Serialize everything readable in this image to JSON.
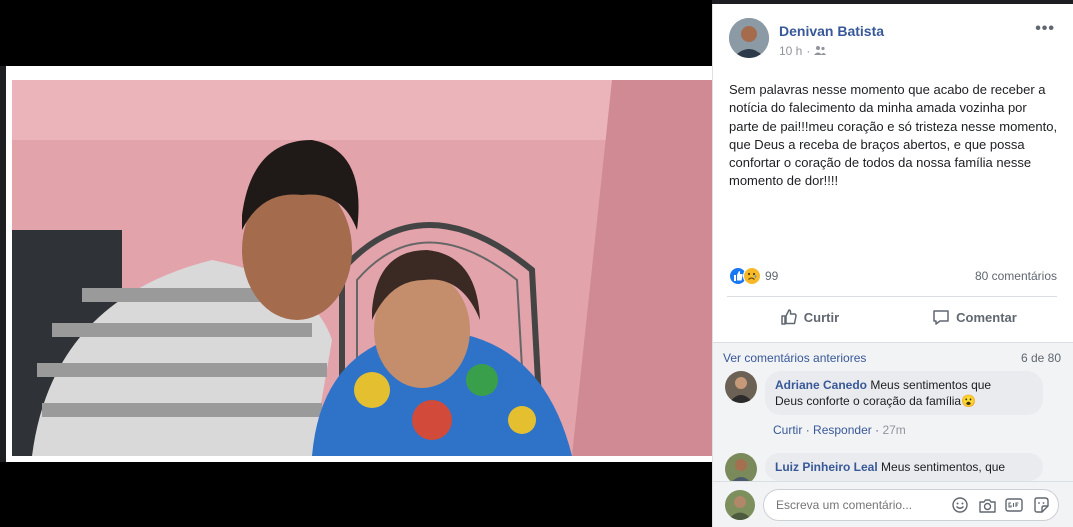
{
  "post": {
    "author": "Denivan Batista",
    "time": "10 h",
    "audience_icon": "friends-icon",
    "more_label": "•••",
    "text": "Sem palavras nesse momento que acabo de receber a notícia do falecimento da minha amada vozinha por parte de pai!!!meu coração e só tristeza nesse momento, que Deus a receba de braços abertos, e que possa confortar o coração de todos da nossa família nesse momento de dor!!!!"
  },
  "reactions": {
    "icons": [
      "like-icon",
      "sad-icon"
    ],
    "count": "99",
    "comments_label": "80 comentários"
  },
  "actions": {
    "like_label": "Curtir",
    "comment_label": "Comentar"
  },
  "comments": {
    "view_previous": "Ver comentários anteriores",
    "pagination": "6 de 80",
    "items": [
      {
        "name": "Adriane Canedo",
        "text_line1": "Meus sentimentos que",
        "text_line2": "Deus conforte o coração da família😮",
        "like": "Curtir",
        "reply": "Responder",
        "time": "27m"
      },
      {
        "name": "Luiz Pinheiro Leal",
        "text_line1": "Meus sentimentos, que"
      }
    ]
  },
  "composer": {
    "placeholder": "Escreva um comentário...",
    "icons": [
      "emoji-icon",
      "camera-icon",
      "gif-icon",
      "sticker-icon"
    ]
  },
  "colors": {
    "link": "#385898",
    "background": "#f2f3f5",
    "wall": "#e8a7ae"
  }
}
